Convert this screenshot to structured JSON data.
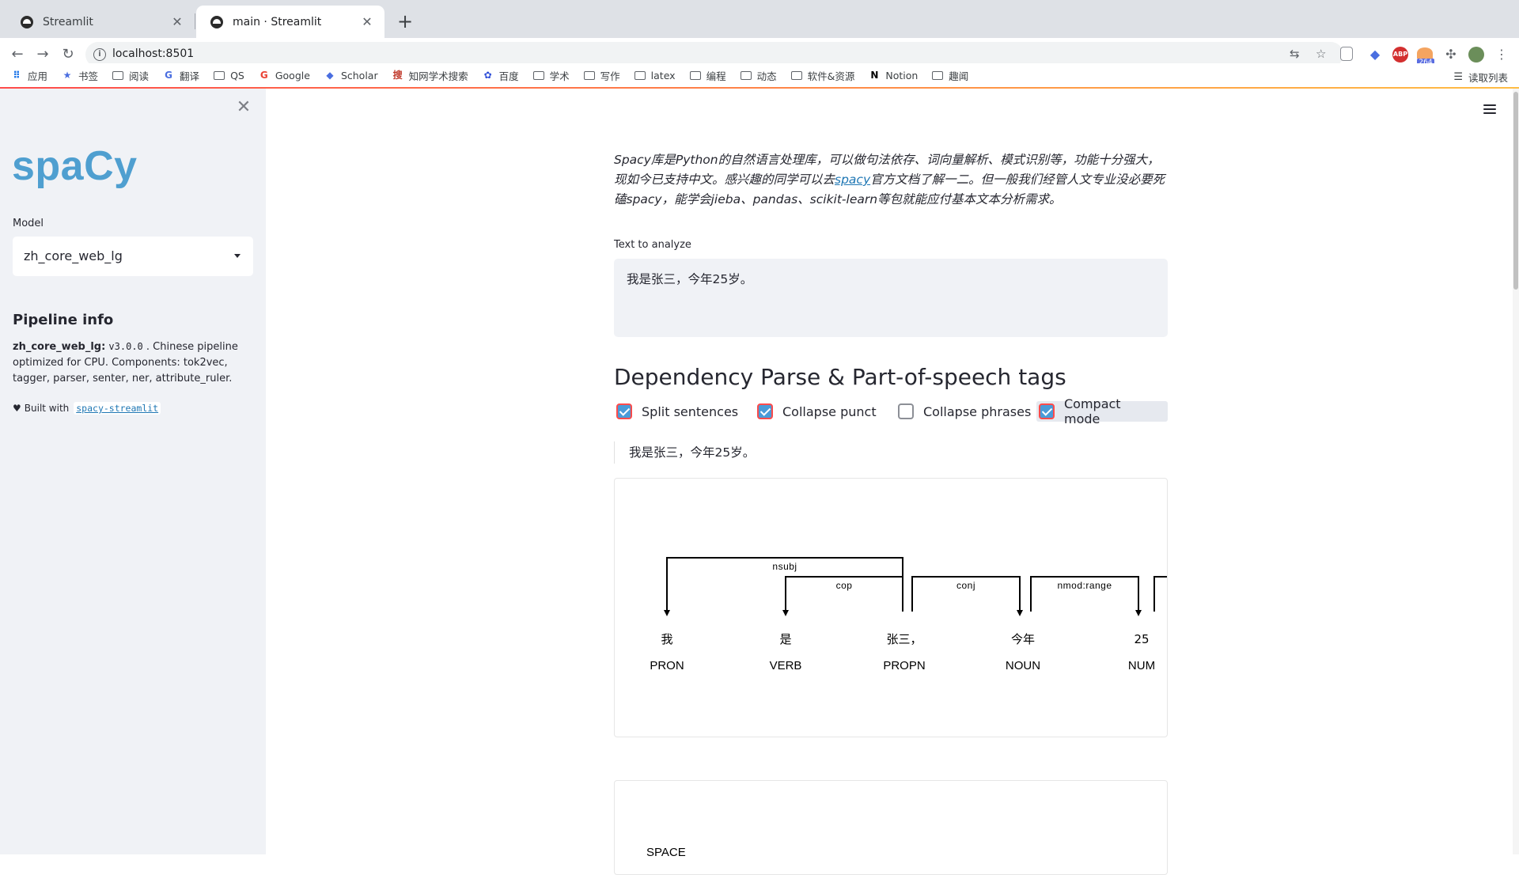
{
  "browser": {
    "tabs": [
      {
        "title": "Streamlit",
        "active": false
      },
      {
        "title": "main · Streamlit",
        "active": true
      }
    ],
    "url": "localhost:8501",
    "bookmarks": [
      {
        "label": "应用",
        "icon": "apps-grid-icon"
      },
      {
        "label": "书签",
        "icon": "star-icon"
      },
      {
        "label": "阅读",
        "icon": "folder-icon"
      },
      {
        "label": "翻译",
        "icon": "translate-icon"
      },
      {
        "label": "QS",
        "icon": "folder-icon"
      },
      {
        "label": "Google",
        "icon": "google-icon"
      },
      {
        "label": "Scholar",
        "icon": "scholar-icon"
      },
      {
        "label": "知网学术搜索",
        "icon": "cnki-icon"
      },
      {
        "label": "百度",
        "icon": "baidu-icon"
      },
      {
        "label": "学术",
        "icon": "folder-icon"
      },
      {
        "label": "写作",
        "icon": "folder-icon"
      },
      {
        "label": "latex",
        "icon": "folder-icon"
      },
      {
        "label": "编程",
        "icon": "folder-icon"
      },
      {
        "label": "动态",
        "icon": "folder-icon"
      },
      {
        "label": "软件&资源",
        "icon": "folder-icon"
      },
      {
        "label": "Notion",
        "icon": "notion-icon"
      },
      {
        "label": "趣闻",
        "icon": "folder-icon"
      }
    ],
    "reading_list": "读取列表",
    "extension_badge": "264"
  },
  "sidebar": {
    "logo": "spaCy",
    "model_label": "Model",
    "model_value": "zh_core_web_lg",
    "pipeline_title": "Pipeline info",
    "pipeline_name": "zh_core_web_lg:",
    "pipeline_version": "v3.0.0",
    "pipeline_text": ". Chinese pipeline optimized for CPU. Components: tok2vec, tagger, parser, senter, ner, attribute_ruler.",
    "built_with": "Built with",
    "built_with_link": "spacy-streamlit"
  },
  "main": {
    "intro_part1": "Spacy库是Python的自然语言处理库，可以做句法依存、词向量解析、模式识别等，功能十分强大，现如今已支持中文。感兴趣的同学可以去",
    "intro_link": "spacy",
    "intro_part2": "官方文档了解一二。但一般我们经管人文专业没必要死磕spacy，能学会jieba、pandas、scikit-learn等包就能应付基本文本分析需求。",
    "text_label": "Text to analyze",
    "text_value": "我是张三，今年25岁。",
    "section_title": "Dependency Parse & Part-of-speech tags",
    "options": [
      {
        "label": "Split sentences",
        "checked": true
      },
      {
        "label": "Collapse punct",
        "checked": true
      },
      {
        "label": "Collapse phrases",
        "checked": false
      },
      {
        "label": "Compact mode",
        "checked": true
      }
    ],
    "sentence": "我是张三，今年25岁。",
    "tokens": [
      {
        "text": "我",
        "tag": "PRON"
      },
      {
        "text": "是",
        "tag": "VERB"
      },
      {
        "text": "张三，",
        "tag": "PROPN"
      },
      {
        "text": "今年",
        "tag": "NOUN"
      },
      {
        "text": "25",
        "tag": "NUM"
      }
    ],
    "arcs": [
      {
        "label": "nsubj",
        "start": 0,
        "end": 2,
        "dir": "left"
      },
      {
        "label": "cop",
        "start": 1,
        "end": 2,
        "dir": "left"
      },
      {
        "label": "conj",
        "start": 2,
        "end": 3,
        "dir": "right"
      },
      {
        "label": "nmod:range",
        "start": 3,
        "end": 4,
        "dir": "right"
      }
    ],
    "second_viz_label": "SPACE"
  }
}
